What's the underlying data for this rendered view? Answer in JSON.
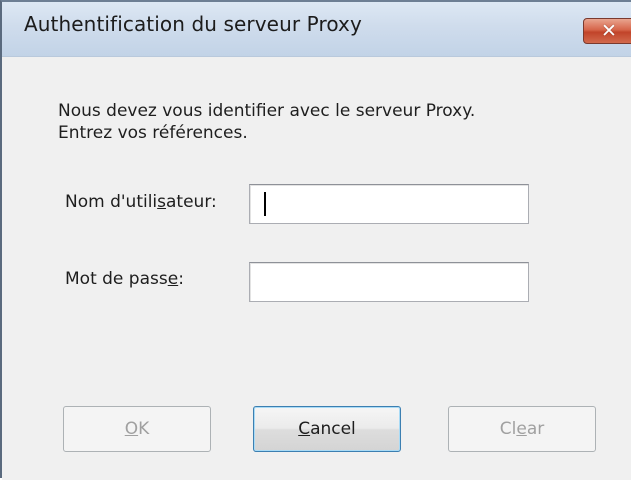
{
  "window": {
    "title": "Authentification du serveur Proxy",
    "close_icon": "close-icon",
    "close_glyph": "✕"
  },
  "message": {
    "line1": "Nous devez vous identifier avec le serveur Proxy.",
    "line2": "Entrez vos références."
  },
  "form": {
    "username": {
      "label_before": "Nom d'utili",
      "label_mnemonic": "s",
      "label_after": "ateur:",
      "value": ""
    },
    "password": {
      "label_before": "Mot de pass",
      "label_mnemonic": "e",
      "label_after": ":",
      "value": ""
    }
  },
  "buttons": {
    "ok": {
      "mnemonic": "O",
      "rest": "K",
      "enabled": false
    },
    "cancel": {
      "mnemonic": "C",
      "rest": "ancel",
      "enabled": true
    },
    "clear": {
      "before": "Cl",
      "mnemonic": "e",
      "rest": "ar",
      "enabled": false
    }
  },
  "colors": {
    "title_bar": "#c9d8eb",
    "close_button": "#d35a3f",
    "dialog_background": "#f0f0f0",
    "disabled_text": "#a0a0a0"
  }
}
